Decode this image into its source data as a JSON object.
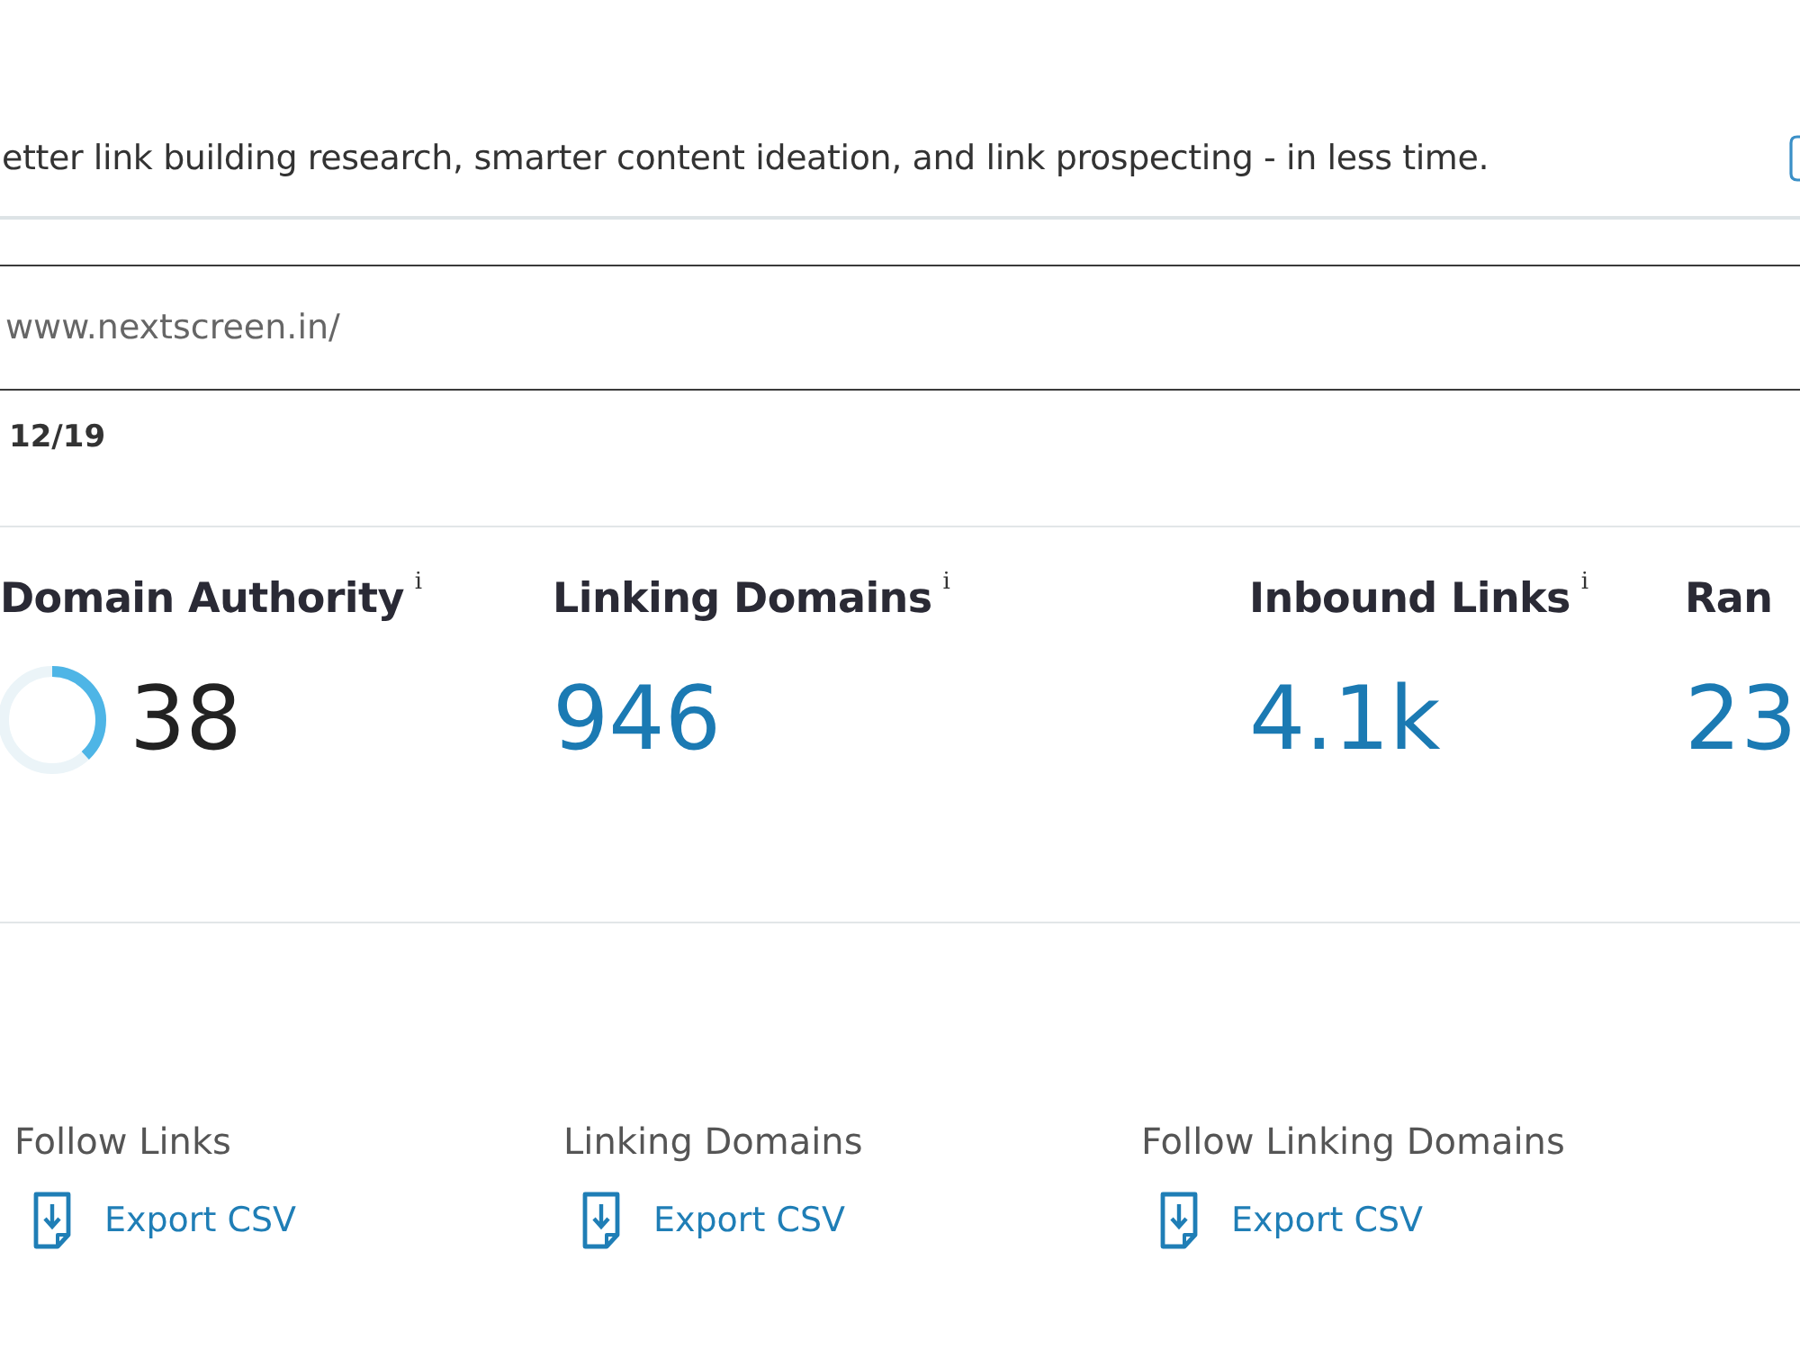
{
  "intro": {
    "text": "etter link building research, smarter content ideation, and link prospecting - in less time."
  },
  "url_field": {
    "value": "www.nextscreen.in/"
  },
  "updated": "12/19",
  "metrics": [
    {
      "kind": "ring",
      "label": "Domain Authority",
      "info": "i",
      "value": "38",
      "level": 0.38
    },
    {
      "kind": "number",
      "label": "Linking Domains",
      "info": "i",
      "value": "946"
    },
    {
      "kind": "number",
      "label": "Inbound Links",
      "info": "i",
      "value": "4.1k"
    },
    {
      "kind": "number",
      "label": "Ran",
      "value": "23"
    }
  ],
  "exports": [
    {
      "title": "Follow Links",
      "link": "Export CSV"
    },
    {
      "title": "Linking Domains",
      "link": "Export CSV"
    },
    {
      "title": "Follow Linking Domains",
      "link": "Export CSV"
    }
  ]
}
